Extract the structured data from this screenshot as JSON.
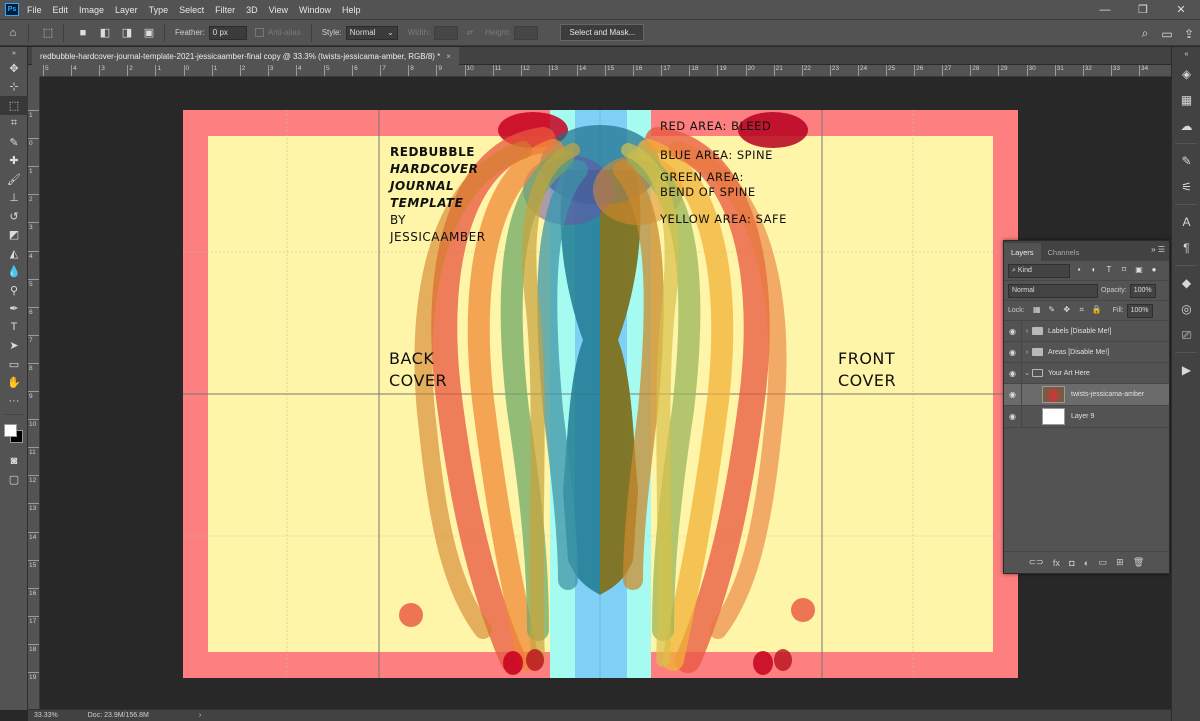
{
  "app": {
    "logo": "Ps"
  },
  "menu": [
    "File",
    "Edit",
    "Image",
    "Layer",
    "Type",
    "Select",
    "Filter",
    "3D",
    "View",
    "Window",
    "Help"
  ],
  "window_controls": {
    "minimize": "—",
    "restore": "❐",
    "close": "✕"
  },
  "options_bar": {
    "feather_label": "Feather:",
    "feather_value": "0 px",
    "antialias_label": "Anti-alias",
    "style_label": "Style:",
    "style_value": "Normal",
    "width_label": "Width:",
    "height_label": "Height:",
    "select_mask_label": "Select and Mask..."
  },
  "document": {
    "tab_title": "redbubble-hardcover-journal-template-2021-jessicaamber-final copy @ 33.3% (twists-jessicama-amber, RGB/8) *",
    "close": "×"
  },
  "rulers": {
    "top": [
      "5",
      "4",
      "3",
      "2",
      "1",
      "0",
      "1",
      "2",
      "3",
      "4",
      "5",
      "6",
      "7",
      "8",
      "9",
      "10",
      "11",
      "12",
      "13",
      "14",
      "15",
      "16",
      "17",
      "18",
      "19",
      "20",
      "21",
      "22",
      "23",
      "24",
      "25",
      "26",
      "27",
      "28",
      "29",
      "30",
      "31",
      "32",
      "33",
      "34",
      "35",
      "36"
    ],
    "left": [
      "1",
      "0",
      "1",
      "2",
      "3",
      "4",
      "5",
      "6",
      "7",
      "8",
      "9",
      "10",
      "11",
      "12",
      "13",
      "14",
      "15",
      "16",
      "17",
      "18",
      "19"
    ]
  },
  "canvas": {
    "title_lines": [
      "REDBUBBLE",
      "HARDCOVER",
      "JOURNAL",
      "TEMPLATE",
      "BY",
      "JESSICAAMBER"
    ],
    "legend_lines": [
      "RED AREA: BLEED",
      "BLUE AREA: SPINE",
      "GREEN AREA:",
      "BEND OF SPINE",
      "YELLOW AREA: SAFE"
    ],
    "back_cover": [
      "BACK",
      "COVER"
    ],
    "front_cover": [
      "FRONT",
      "COVER"
    ],
    "colors": {
      "bleed": "#fd7f7f",
      "safe": "#fef5a8",
      "spine_blue": "#7fd0f7",
      "spine_green": "#a6fbf0"
    }
  },
  "layers_panel": {
    "tabs": [
      "Layers",
      "Channels"
    ],
    "filter_kind": "Kind",
    "blend_mode": "Normal",
    "opacity_label": "Opacity:",
    "opacity_value": "100%",
    "lock_label": "Lock:",
    "fill_label": "Fill:",
    "fill_value": "100%",
    "layers": [
      {
        "name": "Labels [Disable Me!]",
        "type": "group"
      },
      {
        "name": "Areas [Disable Me!]",
        "type": "group"
      },
      {
        "name": "Your Art Here",
        "type": "group-open"
      },
      {
        "name": "twists-jessicama-amber",
        "type": "layer"
      },
      {
        "name": "Layer 9",
        "type": "layer"
      }
    ]
  },
  "status": {
    "zoom": "33.33%",
    "doc": "Doc: 23.9M/156.8M",
    "arrow": "›"
  }
}
